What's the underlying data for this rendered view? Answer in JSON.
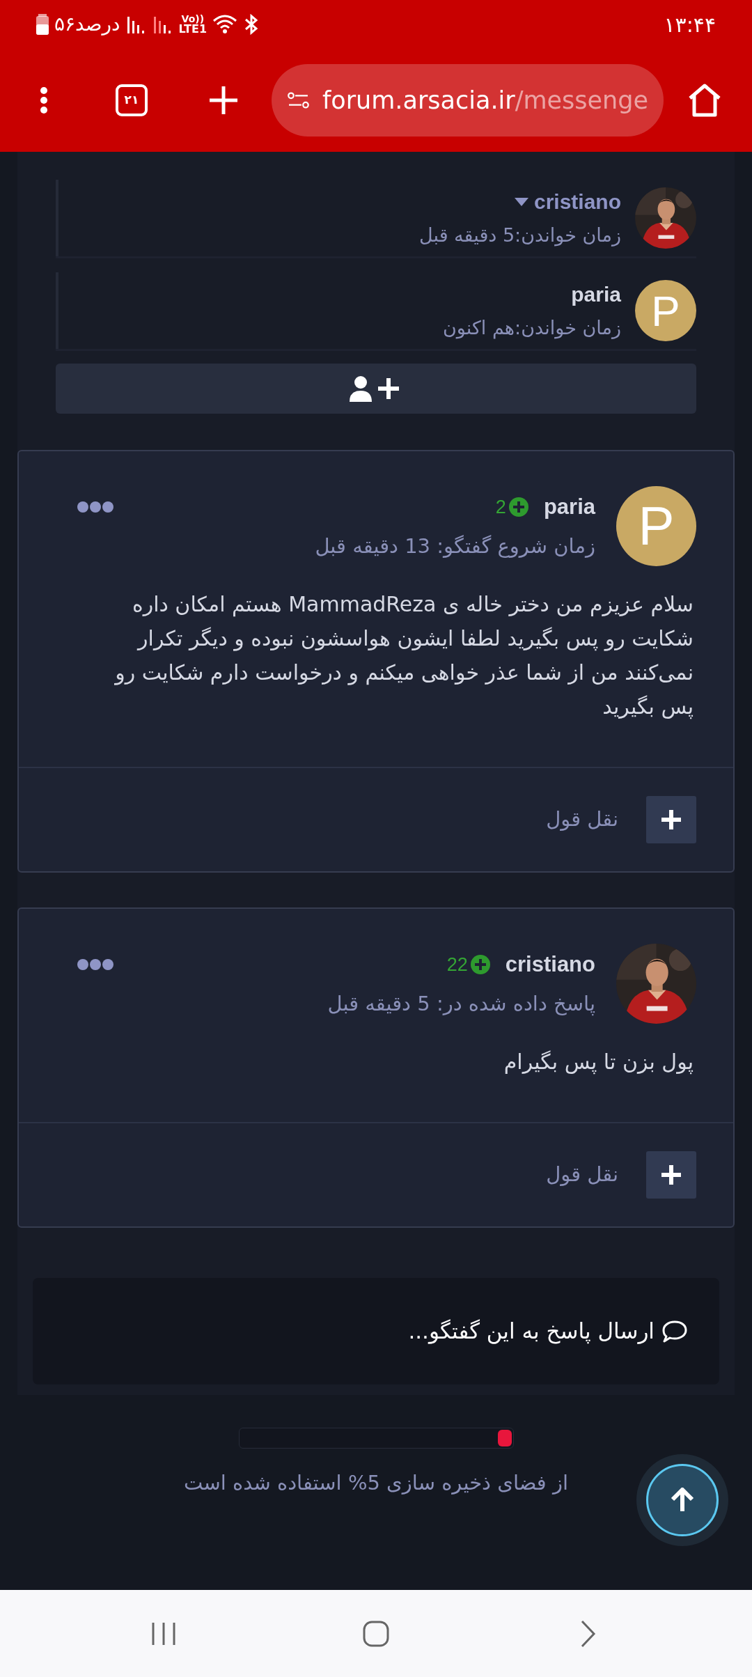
{
  "status_bar": {
    "battery_text": "۵۶درصد",
    "volte": "Vo))",
    "network": "LTE1",
    "time": "۱۳:۴۴"
  },
  "browser": {
    "tab_count": "۲۱",
    "url_host": "forum.arsacia.ir",
    "url_path": "/messenge"
  },
  "readers": [
    {
      "name": "cristiano",
      "dropdown": true,
      "read_time": "زمان خواندن:5 دقیقه قبل"
    },
    {
      "name": "paria",
      "avatar": {
        "kind": "letter",
        "letter": "P"
      },
      "dropdown": false,
      "read_time": "زمان خواندن:هم اکنون"
    }
  ],
  "posts": [
    {
      "author": "paria",
      "avatar": {
        "kind": "letter",
        "letter": "P"
      },
      "score": "2",
      "time": "زمان شروع گفتگو: 13 دقیقه قبل",
      "body": "سلام عزیزم من دختر خاله ی MammadReza هستم امکان داره شکایت رو پس بگیرید لطفا ایشون هواسشون نبوده و دیگر تکرار نمی‌کنند من از شما عذر خواهی میکنم و درخواست دارم شکایت رو پس بگیرید",
      "quote_label": "نقل قول"
    },
    {
      "author": "cristiano",
      "score": "22",
      "time": "پاسخ داده شده در: 5 دقیقه قبل",
      "body": "پول بزن تا پس بگیرام",
      "quote_label": "نقل قول"
    }
  ],
  "reply": {
    "placeholder": "ارسال پاسخ به این گفتگو..."
  },
  "storage": {
    "level": 0.05,
    "text": "از فضای ذخیره سازی 5% استفاده شده است"
  }
}
